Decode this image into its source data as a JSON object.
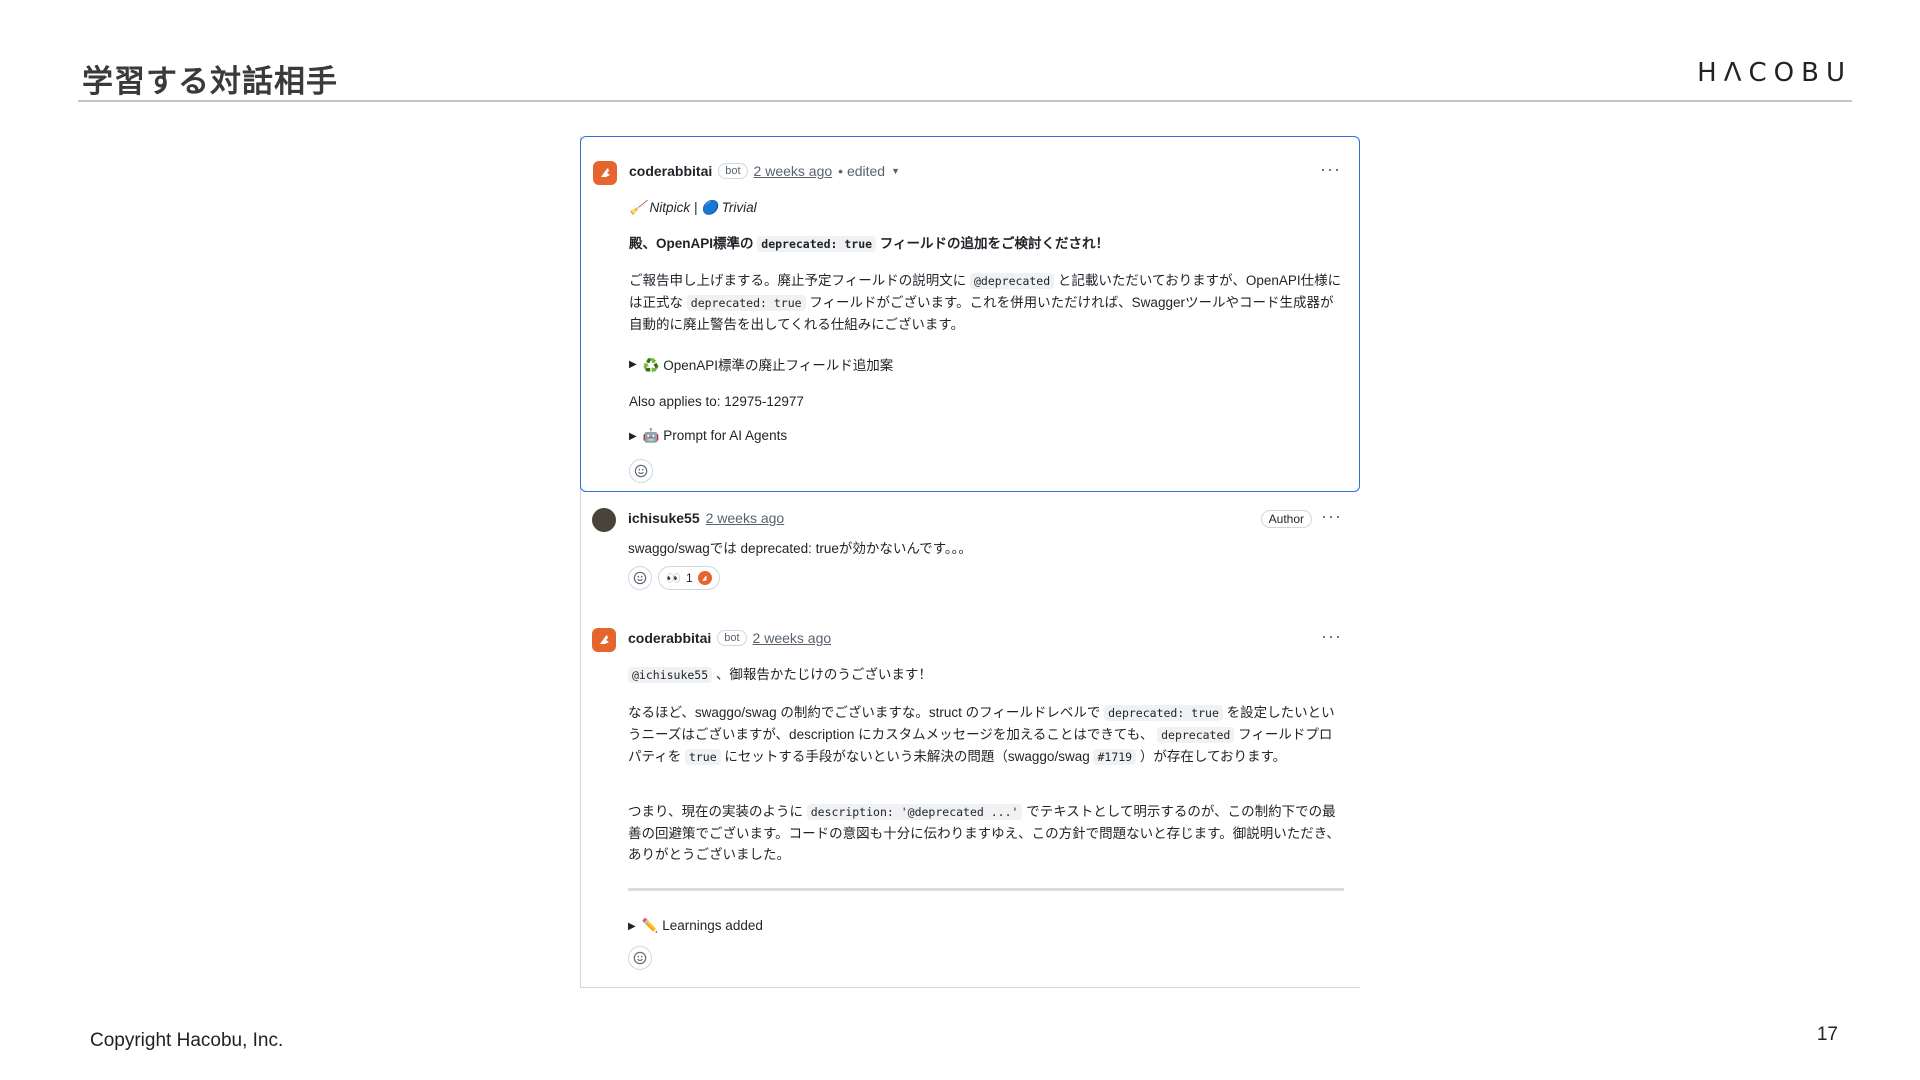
{
  "slide": {
    "title": "学習する対話相手",
    "brand": "HΛCOBU",
    "copyright": "Copyright Hacobu, Inc.",
    "page_number": "17"
  },
  "comments": [
    {
      "username": "coderabbitai",
      "badge": "bot",
      "time": "2 weeks ago",
      "edited": "• edited",
      "tags": "🧹 Nitpick | 🔵 Trivial",
      "heading_pre": "殿、OpenAPI標準の ",
      "heading_code": "deprecated: true",
      "heading_post": " フィールドの追加をご検討くだされ！",
      "para_a": "ご報告申し上げまする。廃止予定フィールドの説明文に ",
      "para_code1": "@deprecated",
      "para_b": " と記載いただいておりますが、OpenAPI仕様には正式な ",
      "para_code2": "deprecated: true",
      "para_c": " フィールドがございます。これを併用いただければ、Swaggerツールやコード生成器が自動的に廃止警告を出してくれる仕組みにございます。",
      "details1": "♻️ OpenAPI標準の廃止フィールド追加案",
      "applies": "Also applies to: 12975-12977",
      "details2": "🤖 Prompt for AI Agents"
    },
    {
      "username": "ichisuke55",
      "time": "2 weeks ago",
      "author_label": "Author",
      "text": "swaggo/swagでは deprecated: trueが効かないんです。。。",
      "reaction_emoji": "👀",
      "reaction_count": "1"
    },
    {
      "username": "coderabbitai",
      "badge": "bot",
      "time": "2 weeks ago",
      "mention": "@ichisuke55",
      "thanks": " 、御報告かたじけのうございます！",
      "p1_a": "なるほど、swaggo/swag の制約でございますな。struct のフィールドレベルで ",
      "p1_code1": "deprecated: true",
      "p1_b": " を設定したいというニーズはございますが、description にカスタムメッセージを加えることはできても、 ",
      "p1_code2": "deprecated",
      "p1_c": " フィールドプロパティを ",
      "p1_code3": "true",
      "p1_d": " にセットする手段がないという未解決の問題（swaggo/swag ",
      "p1_code4": "#1719",
      "p1_e": " ）が存在しております。",
      "p2_a": "つまり、現在の実装のように ",
      "p2_code": "description: '@deprecated ...'",
      "p2_b": " でテキストとして明示するのが、この制約下での最善の回避策でございます。コードの意図も十分に伝わりますゆえ、この方針で問題ないと存じます。御説明いただき、ありがとうございました。",
      "details": "✏️ Learnings added"
    }
  ],
  "icons": {
    "menu": "···",
    "disclosure": "▶",
    "caret": "▼"
  },
  "colors": {
    "selection_border": "#2f6fd6",
    "bot_avatar": "#e5652e",
    "muted_text": "#59636e"
  }
}
